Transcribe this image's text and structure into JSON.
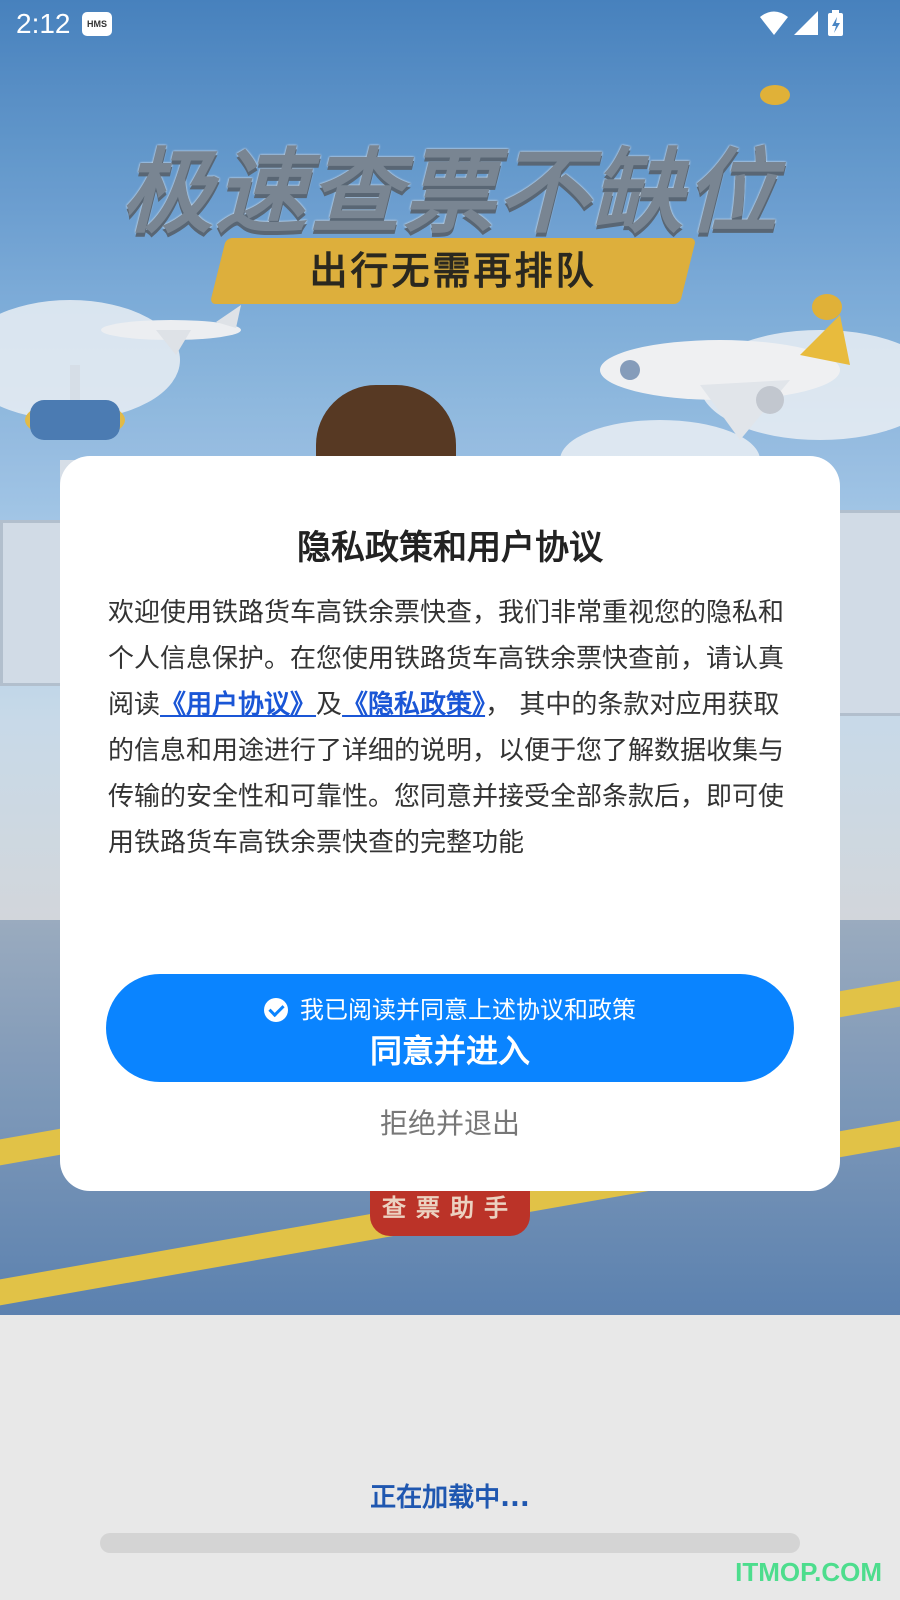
{
  "status_bar": {
    "time": "2:12",
    "hms_label": "HMS",
    "icons": [
      "wifi-icon",
      "signal-icon",
      "battery-charging-icon"
    ]
  },
  "splash": {
    "headline": "极速查票不缺位",
    "subheadline": "出行无需再排队",
    "logo_text": "查票助手"
  },
  "dialog": {
    "title": "隐私政策和用户协议",
    "body_part1": "欢迎使用铁路货车高铁余票快查，我们非常重视您的隐私和个人信息保护。在您使用铁路货车高铁余票快查前，请认真阅读",
    "user_agreement_link": "《用户协议》",
    "connector": "及",
    "privacy_policy_link": "《隐私政策》",
    "body_part2": "， 其中的条款对应用获取的信息和用途进行了详细的说明，以便于您了解数据收集与传输的安全性和可靠性。您同意并接受全部条款后，即可使用铁路货车高铁余票快查的完整功能",
    "checkbox_label": "我已阅读并同意上述协议和政策",
    "checkbox_checked": true,
    "agree_button": "同意并进入",
    "reject_button": "拒绝并退出"
  },
  "loading": {
    "text": "正在加载中...",
    "progress": 0.0
  },
  "watermark": "ITMOP.COM",
  "colors": {
    "primary": "#0a84ff",
    "link": "#1a56d6",
    "loading_text": "#1f57b0"
  }
}
